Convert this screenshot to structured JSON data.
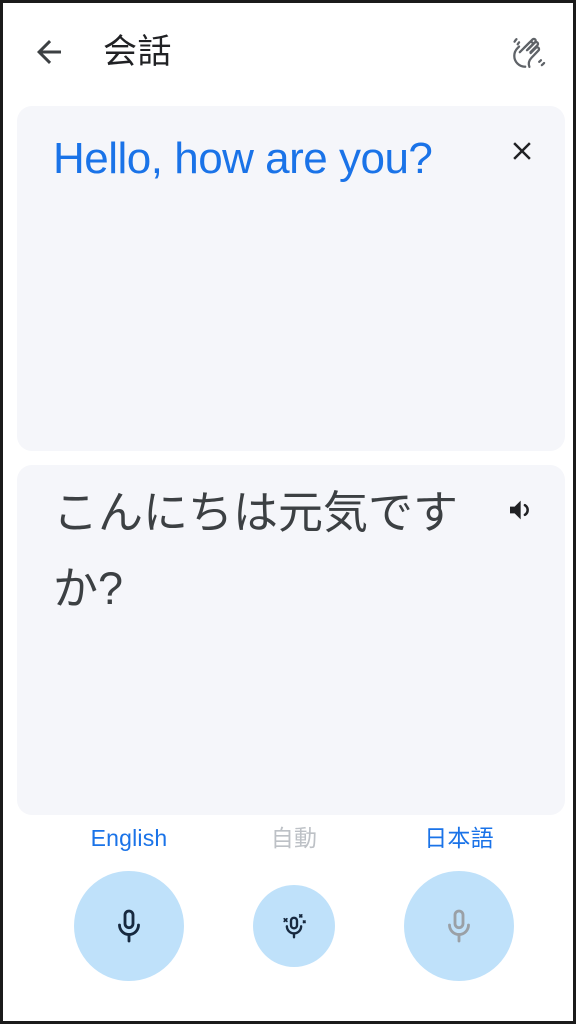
{
  "app": {
    "title": "会話"
  },
  "appbar": {
    "back_icon": "arrow-back-icon",
    "wave_icon": "waving-hand-icon"
  },
  "source_card": {
    "text": "Hello, how are you?",
    "language": "English",
    "close_icon": "close-icon",
    "text_color": "#1a73e8",
    "background": "#f5f6fa"
  },
  "target_card": {
    "text": "こんにちは元気ですか?",
    "language": "日本語",
    "speaker_icon": "volume-up-icon",
    "text_color": "#3c4043",
    "background": "#f5f6fa"
  },
  "mic_bar": {
    "buttons": [
      {
        "label": "English",
        "label_color": "#1a73e8",
        "icon": "microphone-icon",
        "icon_color": "#17293f",
        "circle_color": "#bfe1fa",
        "state": "active"
      },
      {
        "label": "自動",
        "label_color": "#bdc1c6",
        "icon": "microphone-auto-detect-icon",
        "icon_color": "#17293f",
        "circle_color": "#bfe1fa",
        "state": "auto"
      },
      {
        "label": "日本語",
        "label_color": "#1a73e8",
        "icon": "microphone-icon",
        "icon_color": "#9aa0a6",
        "circle_color": "#bfe1fa",
        "state": "inactive"
      }
    ]
  },
  "colors": {
    "accent_blue": "#1a73e8",
    "card_background": "#f5f6fa",
    "page_background": "#ffffff",
    "mic_circle": "#bfe1fa",
    "muted_grey": "#9aa0a6"
  }
}
